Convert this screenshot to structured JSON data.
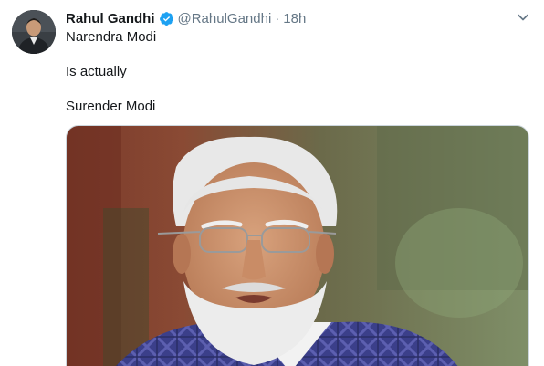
{
  "author": {
    "name": "Rahul Gandhi",
    "handle": "@RahulGandhi",
    "separator": "·",
    "time": "18h"
  },
  "tweet": {
    "lines": [
      "Narendra Modi",
      "Is actually",
      "Surender Modi"
    ]
  },
  "icons": {
    "verified": "verified-badge-icon",
    "menu": "chevron-down-icon"
  },
  "colors": {
    "verified_blue": "#1da1f2",
    "secondary_text": "#657786",
    "primary_text": "#14171a"
  }
}
